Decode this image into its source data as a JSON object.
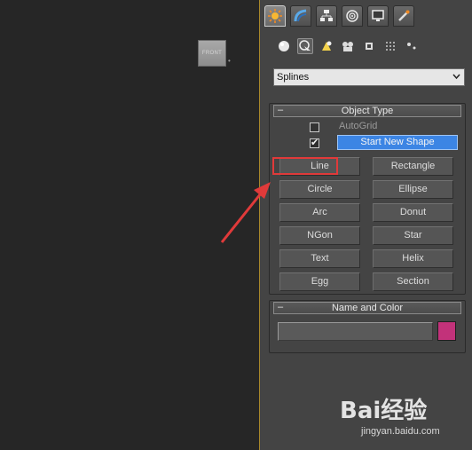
{
  "viewport": {
    "viewcube_label": "FRONT"
  },
  "command_panel": {
    "tabs": [
      {
        "name": "create-tab-icon",
        "active": true
      },
      {
        "name": "modify-tab-icon",
        "active": false
      },
      {
        "name": "hierarchy-tab-icon",
        "active": false
      },
      {
        "name": "motion-tab-icon",
        "active": false
      },
      {
        "name": "display-tab-icon",
        "active": false
      },
      {
        "name": "utilities-tab-icon",
        "active": false
      }
    ],
    "categories": [
      {
        "name": "geometry-icon",
        "active": false
      },
      {
        "name": "shapes-icon",
        "active": true
      },
      {
        "name": "lights-icon",
        "active": false
      },
      {
        "name": "cameras-icon",
        "active": false
      },
      {
        "name": "helpers-icon",
        "active": false
      },
      {
        "name": "space-warps-icon",
        "active": false
      },
      {
        "name": "systems-icon",
        "active": false
      }
    ],
    "dropdown_value": "Splines",
    "object_type": {
      "header": "Object Type",
      "collapse_symbol": "–",
      "autogrid_label": "AutoGrid",
      "autogrid_checked": false,
      "start_new_shape_checked": true,
      "start_new_shape_label": "Start New Shape",
      "buttons": [
        "Line",
        "Rectangle",
        "Circle",
        "Ellipse",
        "Arc",
        "Donut",
        "NGon",
        "Star",
        "Text",
        "Helix",
        "Egg",
        "Section"
      ]
    },
    "name_and_color": {
      "header": "Name and Color",
      "collapse_symbol": "–",
      "name_value": "",
      "color": "#c2327a"
    }
  },
  "colors": {
    "viewport_bg": "#262626",
    "panel_bg": "#444444",
    "active_button": "#3c85e4",
    "annotation": "#e03a3a"
  },
  "watermark": {
    "logo_text": "Bai经验",
    "url": "jingyan.baidu.com"
  }
}
